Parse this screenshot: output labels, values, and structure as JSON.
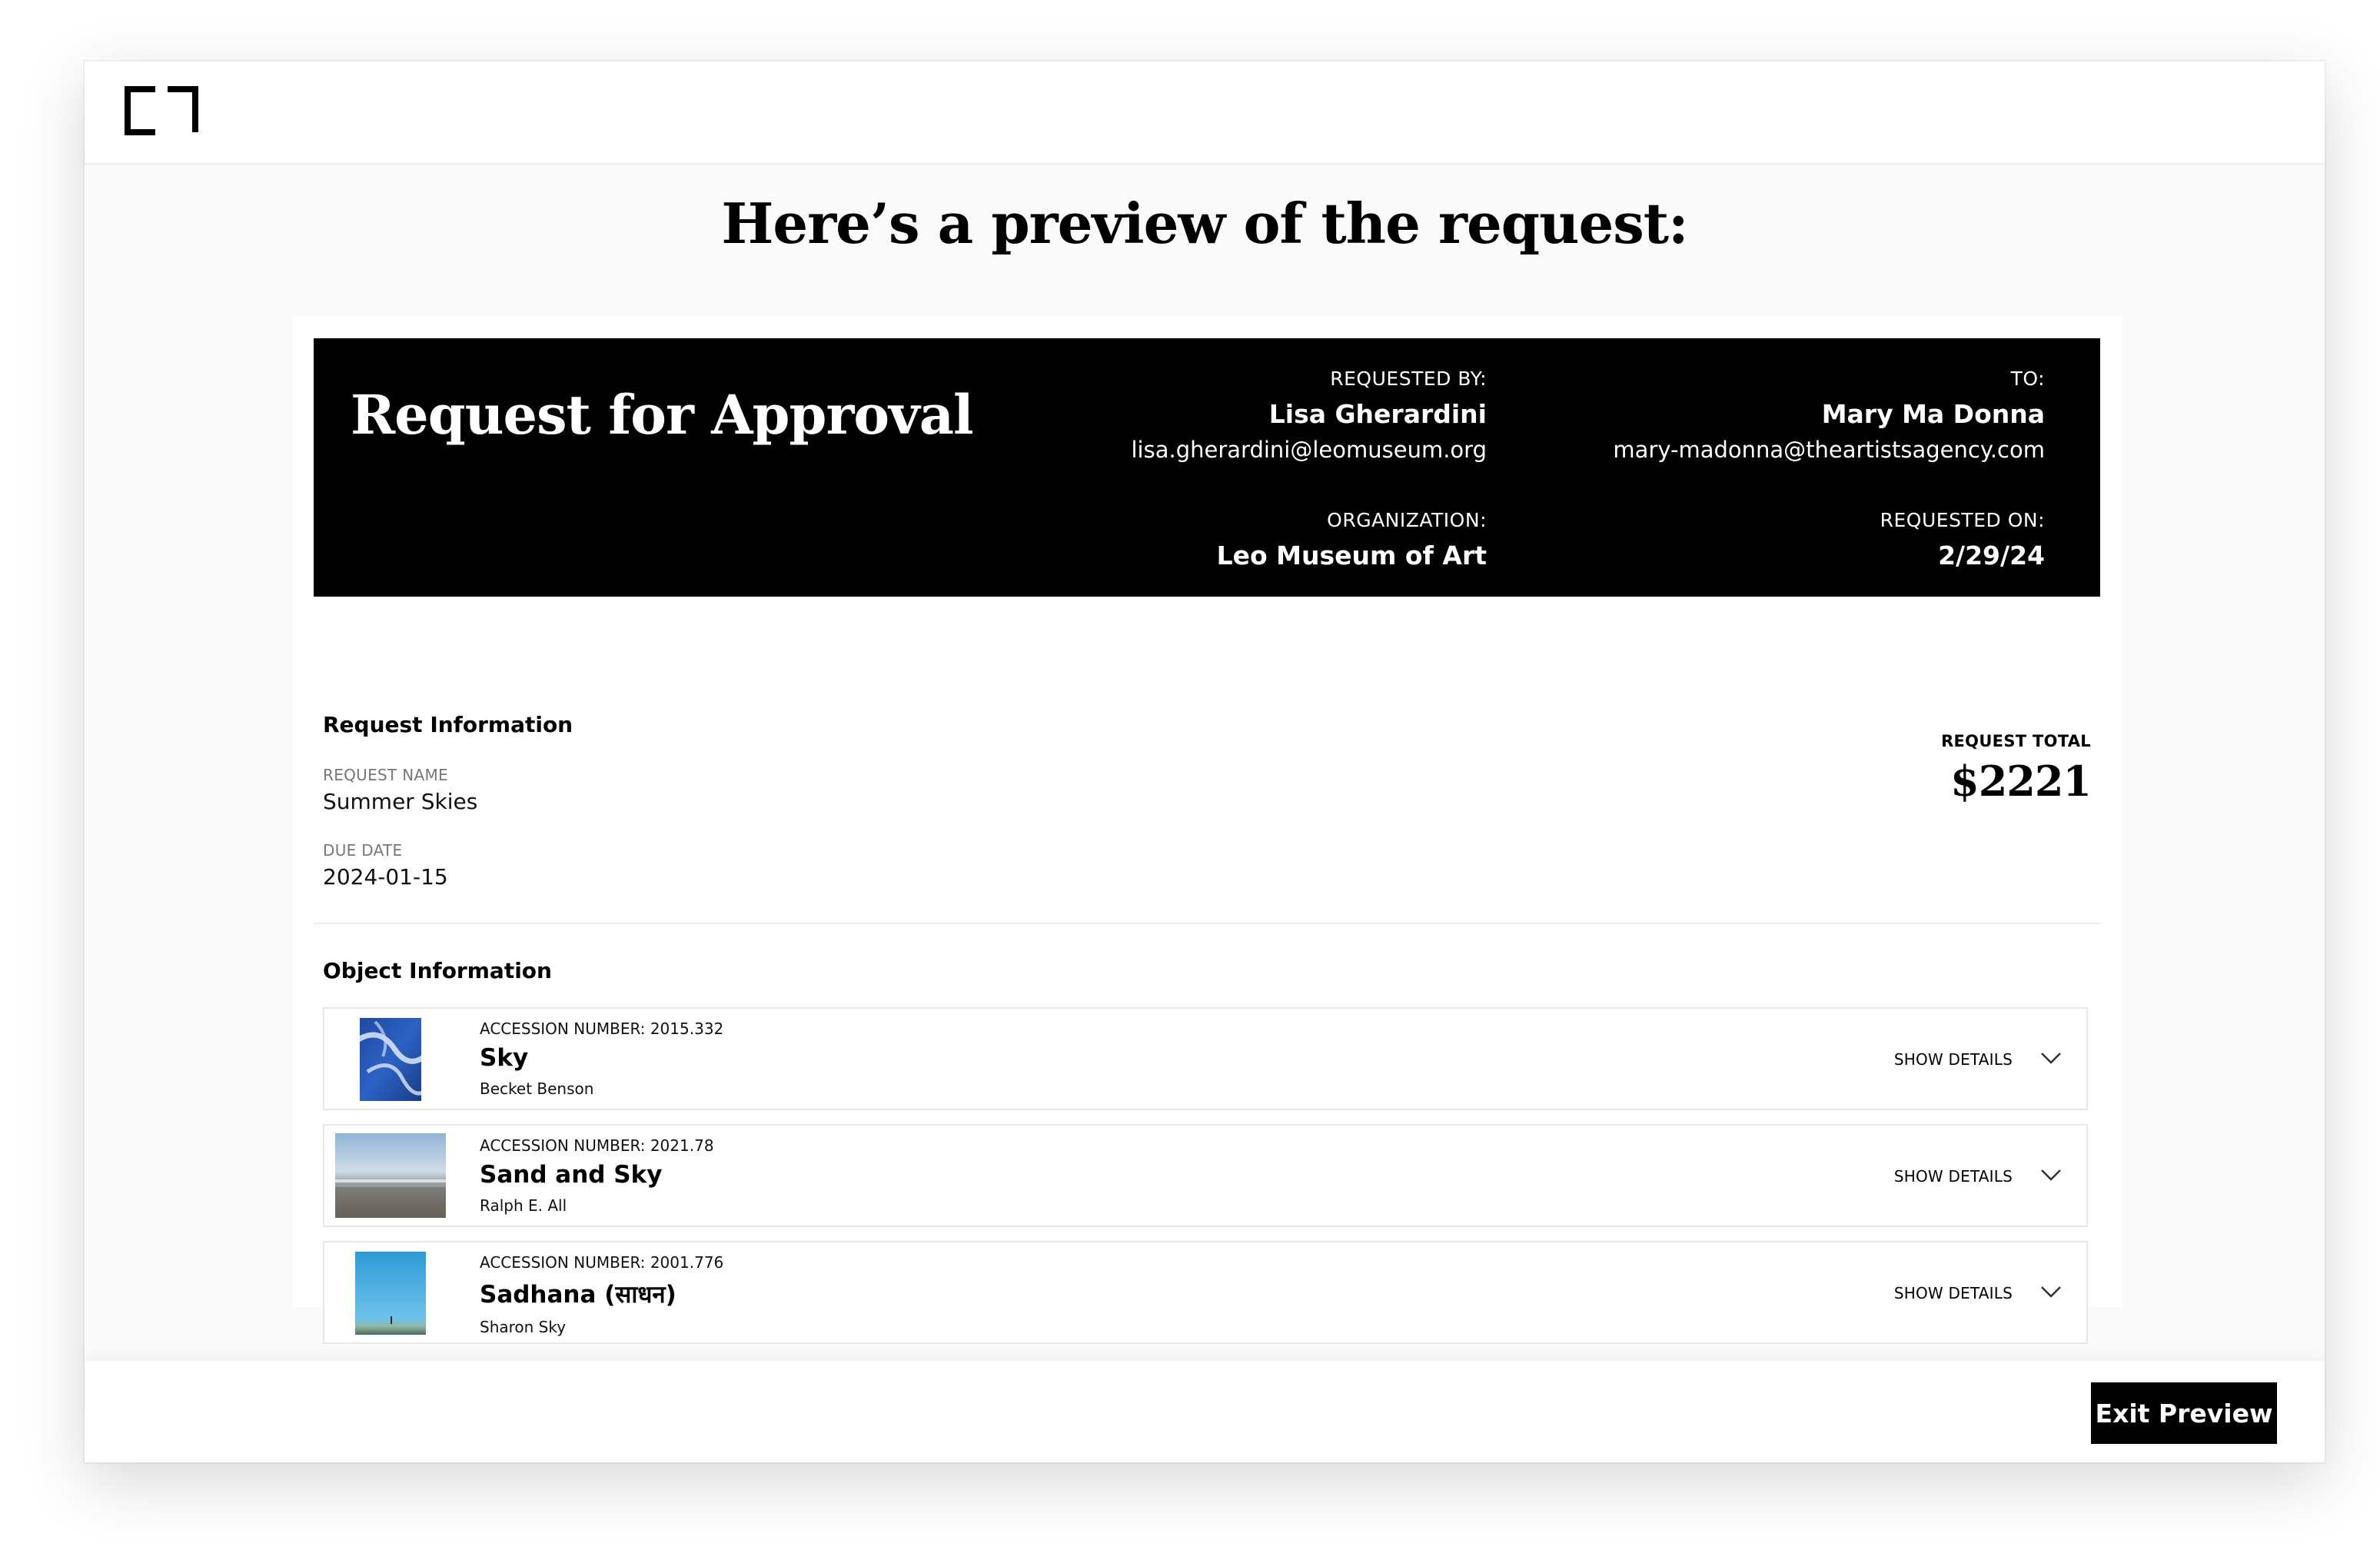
{
  "page": {
    "headline": "Here’s a preview of the request:"
  },
  "header": {
    "logo_icon": "bracket-logo-icon"
  },
  "banner": {
    "title": "Request for Approval",
    "requested_by_label": "REQUESTED BY:",
    "requested_by_name": "Lisa Gherardini",
    "requested_by_email": "lisa.gherardini@leomuseum.org",
    "to_label": "TO:",
    "to_name": "Mary Ma Donna",
    "to_email": "mary-madonna@theartistsagency.com",
    "organization_label": "ORGANIZATION:",
    "organization_name": "Leo Museum of Art",
    "requested_on_label": "REQUESTED ON:",
    "requested_on_value": "2/29/24"
  },
  "request_info": {
    "section_title": "Request Information",
    "request_name_label": "REQUEST NAME",
    "request_name_value": "Summer Skies",
    "due_date_label": "DUE DATE",
    "due_date_value": "2024-01-15",
    "total_label": "REQUEST TOTAL",
    "total_value": "$2221"
  },
  "object_info": {
    "section_title": "Object Information",
    "show_details_label": "SHOW DETAILS",
    "items": [
      {
        "accession": "ACCESSION NUMBER: 2015.332",
        "title": "Sky",
        "artist": "Becket Benson"
      },
      {
        "accession": "ACCESSION NUMBER: 2021.78",
        "title": "Sand and Sky",
        "artist": "Ralph E. All"
      },
      {
        "accession": "ACCESSION NUMBER: 2001.776",
        "title": "Sadhana (साधन)",
        "artist": "Sharon Sky"
      }
    ]
  },
  "footer": {
    "exit_label": "Exit Preview"
  }
}
